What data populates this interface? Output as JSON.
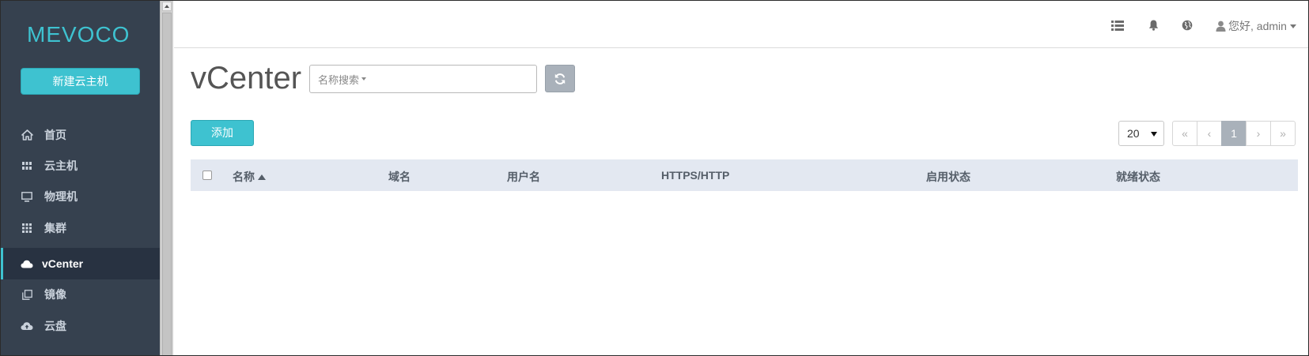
{
  "sidebar": {
    "logo_text": "MEVOCO",
    "new_vm_label": "新建云主机",
    "items": [
      {
        "label": "首页",
        "icon": "home-icon"
      },
      {
        "label": "云主机",
        "icon": "vm-grid-icon"
      },
      {
        "label": "物理机",
        "icon": "monitor-icon"
      },
      {
        "label": "集群",
        "icon": "cluster-grid-icon"
      },
      {
        "label": "vCenter",
        "icon": "cloud-icon",
        "active": true
      },
      {
        "label": "镜像",
        "icon": "image-copy-icon"
      },
      {
        "label": "云盘",
        "icon": "cloud-upload-icon"
      }
    ]
  },
  "topbar": {
    "user_label": "您好, admin"
  },
  "page": {
    "title": "vCenter",
    "search_type": "名称搜索",
    "search_value": "",
    "add_label": "添加",
    "page_size": "20"
  },
  "pagination": {
    "first": "«",
    "prev": "‹",
    "current": "1",
    "next": "›",
    "last": "»"
  },
  "table": {
    "columns": [
      "名称",
      "域名",
      "用户名",
      "HTTPS/HTTP",
      "启用状态",
      "就绪状态"
    ],
    "sort_column": "名称",
    "sort_direction": "ascending",
    "rows": []
  },
  "colors": {
    "sidebar_bg": "#36414f",
    "sidebar_active_bg": "#283241",
    "accent": "#3ec2d0",
    "table_header_bg": "#e3e8f1",
    "pager_active": "#a9b1ba"
  }
}
